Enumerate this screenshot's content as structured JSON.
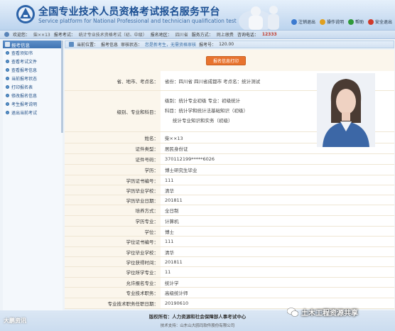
{
  "header": {
    "title_cn": "全国专业技术人员资格考试报名服务平台",
    "title_en": "Service platform for National Professional and technician qualification test",
    "links": [
      {
        "label": "注销退出",
        "color": "#3b7ad0"
      },
      {
        "label": "操作说明",
        "color": "#e0a020"
      },
      {
        "label": "帮助",
        "color": "#2f9a3a"
      },
      {
        "label": "安全退出",
        "color": "#d03a2a"
      }
    ]
  },
  "infobar": {
    "welcome_label": "欢迎您：",
    "welcome_name": "柴××13",
    "exam_label": "报考考试：",
    "exam_value": "统计专业技术资格考试（初、中级）",
    "region_label": "报名地区：",
    "region_value": "四川省",
    "service_label": "服务方式：",
    "service_value": "网上缴费",
    "phone_label": "咨询电话：",
    "phone_value": "12333"
  },
  "sidebar": {
    "title": "报考信息",
    "items": [
      {
        "label": "查看须知书"
      },
      {
        "label": "查看考试文件"
      },
      {
        "label": "查看报考信息"
      },
      {
        "label": "当前报考状态"
      },
      {
        "label": "打印报名表"
      },
      {
        "label": "修改报名信息"
      },
      {
        "label": "考生报考说明"
      },
      {
        "label": "退出当前考试"
      }
    ]
  },
  "crumb": {
    "label": "当前位置：",
    "path": "报考信息",
    "status_label": "审核状态：",
    "status_value": "您是新考生，无需资格审核",
    "number_label": "报考号：",
    "number_value": "120.00"
  },
  "print_button": "报名信息打印",
  "form": {
    "exam_place_label": "省、地市、考点名：",
    "exam_place_value": "省份：四川省   四川省成都市   考点名：统计测试",
    "category_label": "级别、专业和科目：",
    "category_lines": [
      "级别：统计专业初级   专业：初级统计",
      "科目：统计学和统计法基础知识（初级）",
      "统计专业知识和实务（初级）"
    ],
    "fields": [
      {
        "label": "姓名：",
        "value": "柴××13"
      },
      {
        "label": "证件类型：",
        "value": "居民身份证"
      },
      {
        "label": "证件号码：",
        "value": "370112199*****6026"
      },
      {
        "label": "学历：",
        "value": "博士研究生毕业"
      },
      {
        "label": "学历证书编号：",
        "value": "111"
      },
      {
        "label": "学历毕业学校：",
        "value": "清华"
      },
      {
        "label": "学历毕业日期：",
        "value": "201811"
      },
      {
        "label": "培养方式：",
        "value": "全日制"
      },
      {
        "label": "学历专业：",
        "value": "计算机"
      },
      {
        "label": "学位：",
        "value": "博士"
      },
      {
        "label": "学位证书编号：",
        "value": "111"
      },
      {
        "label": "学位毕业学校：",
        "value": "清华"
      },
      {
        "label": "学位获得时间：",
        "value": "201811"
      },
      {
        "label": "学位所学专业：",
        "value": "11"
      },
      {
        "label": "允许报名专业：",
        "value": "统计学"
      },
      {
        "label": "专业技术职务：",
        "value": "高级统计师"
      },
      {
        "label": "专业技术职务任职日期：",
        "value": "20190610"
      }
    ]
  },
  "footer": {
    "copyright": "版权所有：人力资源和社会保障部人事考试中心",
    "support": "技术支持：山东山大鸥玛软件股份有限公司"
  },
  "watermark_left": "大鹏资讯",
  "watermark_right": "土木工程资源共享"
}
